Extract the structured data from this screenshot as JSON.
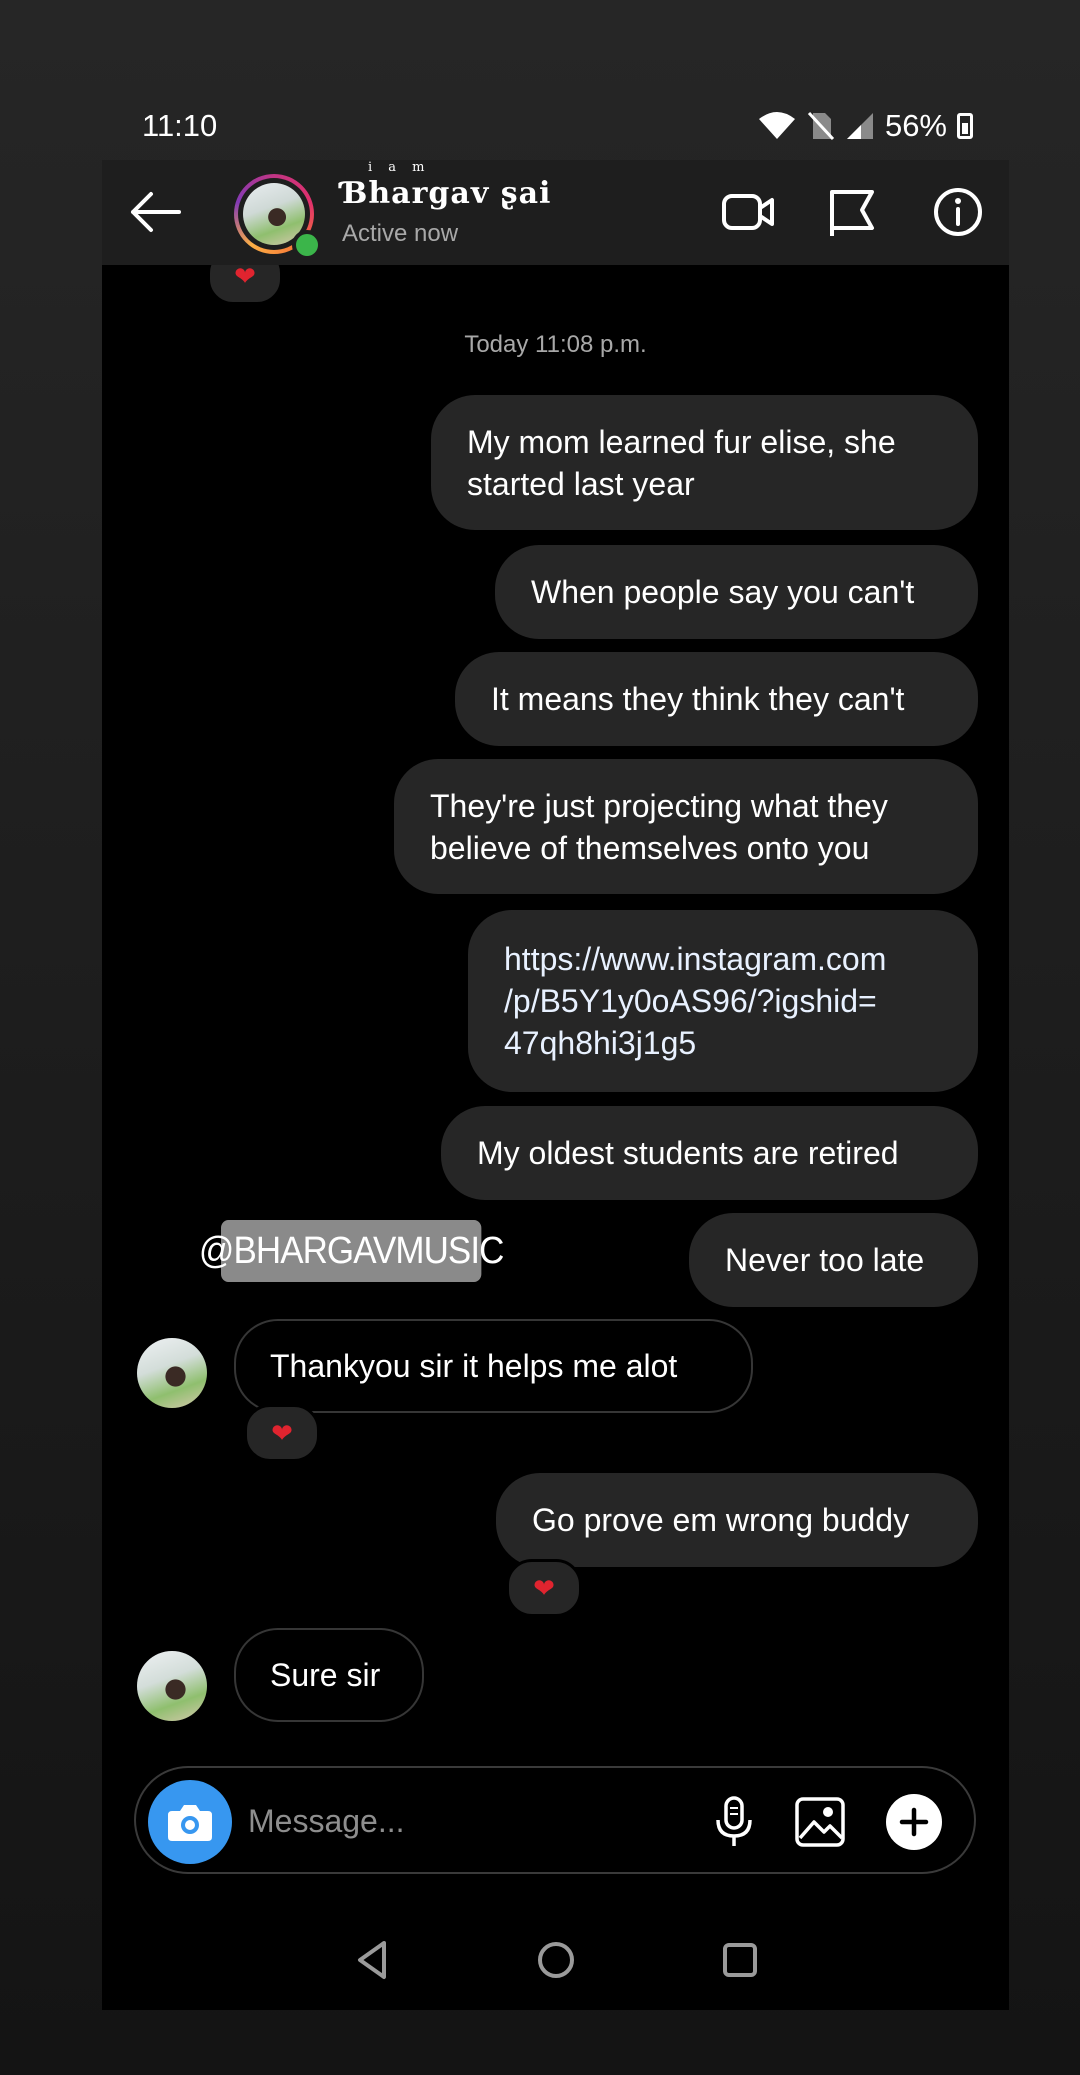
{
  "status_bar": {
    "time": "11:10",
    "battery": "56%"
  },
  "header": {
    "contact_name": "Ɓhargav ʂai",
    "name_superscript": "i a m",
    "active_status": "Active now"
  },
  "chat": {
    "timestamp": "Today 11:08 p.m.",
    "top_reaction": "❤",
    "messages": [
      {
        "from": "me",
        "lines": [
          "My mom learned fur elise, she",
          "started last year"
        ]
      },
      {
        "from": "me",
        "lines": [
          "When people say you can't"
        ]
      },
      {
        "from": "me",
        "lines": [
          "It means they think they can't"
        ]
      },
      {
        "from": "me",
        "lines": [
          "They're just projecting what they",
          "believe of themselves onto you"
        ]
      },
      {
        "from": "me",
        "lines": [
          "https://www.instagram.com",
          "/p/B5Y1y0oAS96/?igshid=",
          "47qh8hi3j1g5"
        ]
      },
      {
        "from": "me",
        "lines": [
          "My oldest students are retired"
        ]
      },
      {
        "from": "me",
        "lines": [
          "Never too late"
        ]
      },
      {
        "from": "them",
        "lines": [
          "Thankyou sir it helps me alot"
        ],
        "reaction": "❤"
      },
      {
        "from": "me",
        "lines": [
          "Go prove em wrong buddy"
        ],
        "reaction": "❤"
      },
      {
        "from": "them",
        "lines": [
          "Sure sir"
        ]
      }
    ],
    "watermark": "@BHARGAVMUSIC"
  },
  "composer": {
    "placeholder": "Message..."
  },
  "icons": [
    "back-arrow-icon",
    "video-call-icon",
    "flag-icon",
    "info-icon",
    "camera-icon",
    "microphone-icon",
    "gallery-icon",
    "plus-icon",
    "nav-back-icon",
    "nav-home-icon",
    "nav-recents-icon"
  ],
  "colors": {
    "bubble": "#262626",
    "background": "#000000",
    "camera_button": "#3797f0",
    "reaction_heart": "#e0242f",
    "online": "#3bb54a"
  }
}
